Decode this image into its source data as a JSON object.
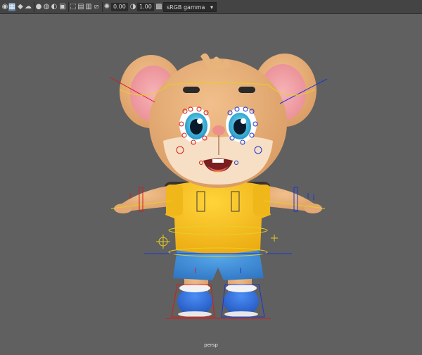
{
  "toolbar": {
    "icons": [
      "camera-icon",
      "grid-icon",
      "cube-icon",
      "light-icon",
      "shade-icon",
      "texture-icon",
      "isolate-icon",
      "xray-icon",
      "wireframe-icon",
      "resolution-gate-icon",
      "film-gate-icon",
      "safe-frame-icon",
      "exposure-icon",
      "gamma-icon"
    ],
    "exposure_value": "0.00",
    "gamma_value": "1.00",
    "color_space": "sRGB gamma"
  },
  "viewport": {
    "camera_label": "persp"
  },
  "colors": {
    "toolbar_bg": "#444444",
    "viewport_bg": "#606060",
    "shirt": "#f5c21a",
    "shorts": "#3f8fd8",
    "fur": "#e8b07c",
    "ear_inner": "#f3a3a8",
    "shoe": "#2f6fe0"
  }
}
